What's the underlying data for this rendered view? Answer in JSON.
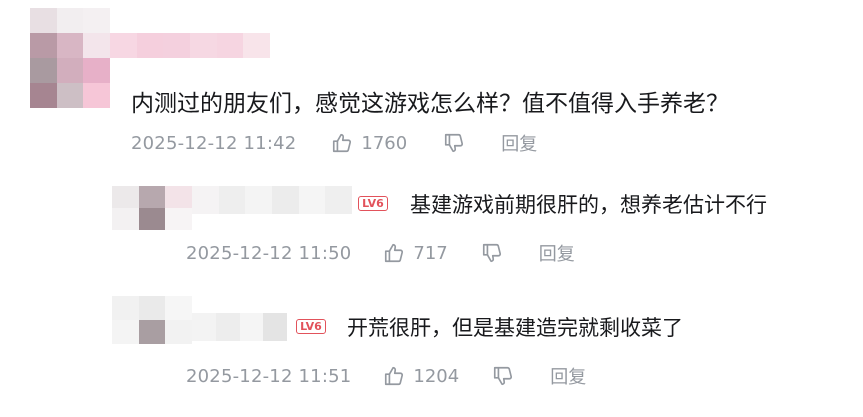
{
  "comments": [
    {
      "text": "内测过的朋友们，感觉这游戏怎么样？值不值得入手养老？",
      "time": "2025-12-12 11:42",
      "likes": "1760",
      "reply_label": "回复",
      "replies": [
        {
          "level": "LV6",
          "text": "基建游戏前期很肝的，想养老估计不行",
          "time": "2025-12-12 11:50",
          "likes": "717",
          "reply_label": "回复"
        },
        {
          "level": "LV6",
          "text": "开荒很肝，但是基建造完就剩收菜了",
          "time": "2025-12-12 11:51",
          "likes": "1204",
          "reply_label": "回复"
        }
      ]
    }
  ],
  "colors": {
    "text": "#18191c",
    "meta": "#9499a0",
    "level_badge": "#e2525b",
    "background": "#ffffff"
  },
  "icons": {
    "like": "thumbs-up-icon",
    "dislike": "thumbs-down-icon"
  }
}
